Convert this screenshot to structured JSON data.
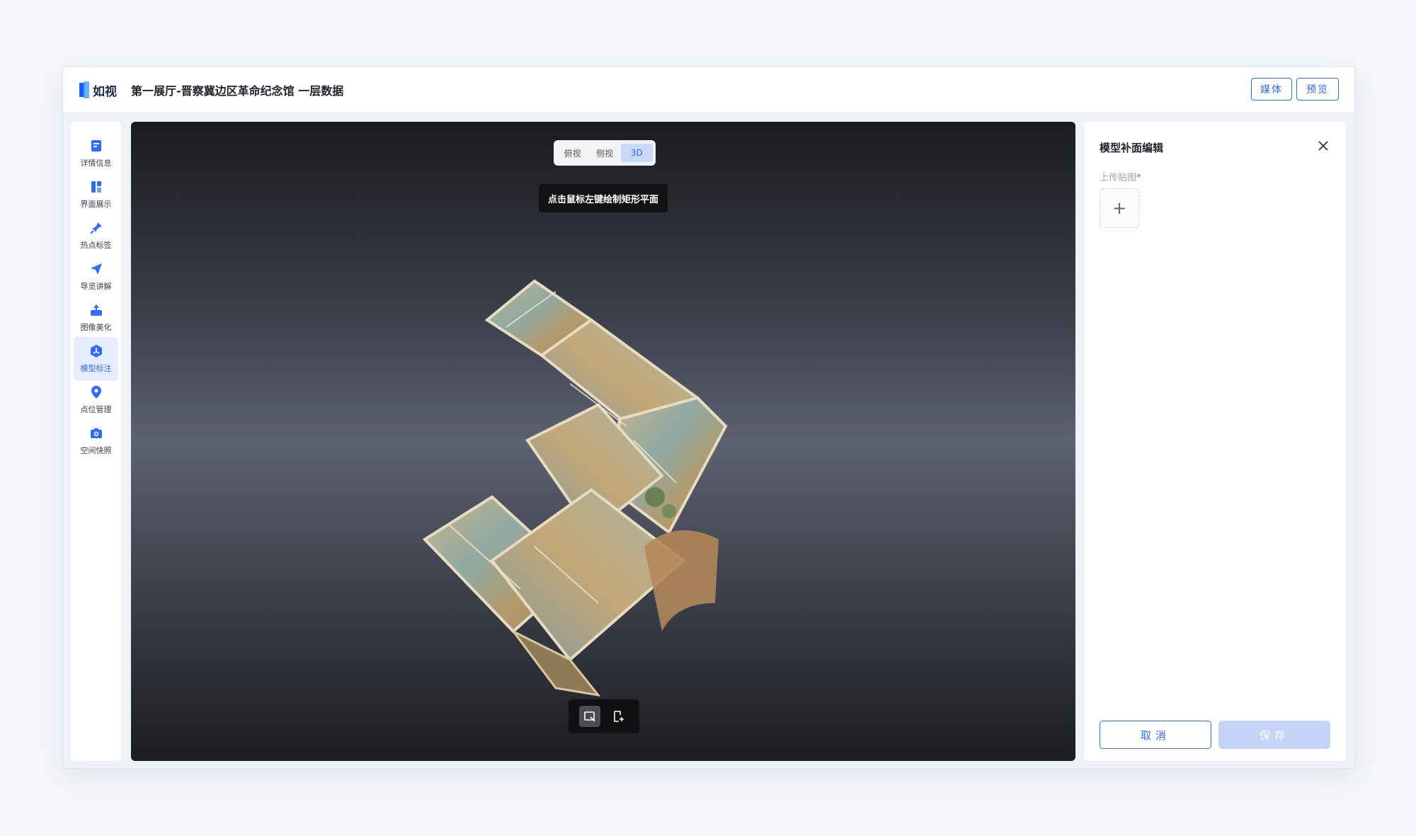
{
  "app": {
    "logo_text": "如视",
    "title": "第一展厅-晋察冀边区革命纪念馆 一层数据"
  },
  "header": {
    "media_label": "媒体",
    "preview_label": "预览"
  },
  "sidebar": {
    "items": [
      {
        "label": "详情信息",
        "icon": "document-icon"
      },
      {
        "label": "界面展示",
        "icon": "layout-icon"
      },
      {
        "label": "热点标签",
        "icon": "pin-icon"
      },
      {
        "label": "导览讲解",
        "icon": "navigate-icon"
      },
      {
        "label": "图像美化",
        "icon": "image-upload-icon"
      },
      {
        "label": "模型标注",
        "icon": "model-icon",
        "active": true
      },
      {
        "label": "点位管理",
        "icon": "location-icon"
      },
      {
        "label": "空间快照",
        "icon": "camera-icon"
      }
    ]
  },
  "viewport": {
    "tabs": [
      {
        "label": "俯视"
      },
      {
        "label": "侧视"
      },
      {
        "label": "3D",
        "active": true
      }
    ],
    "tooltip": "点击鼠标左键绘制矩形平面",
    "tools": [
      "draw-rect-icon",
      "add-plane-icon"
    ]
  },
  "panel": {
    "title": "模型补面编辑",
    "upload_label": "上传贴图",
    "required_mark": "*",
    "upload_plus": "+",
    "cancel_label": "取消",
    "save_label": "保存"
  },
  "colors": {
    "accent": "#2f6bff",
    "active_bg": "#e4ecfd",
    "save_disabled": "#c3d4f6"
  }
}
